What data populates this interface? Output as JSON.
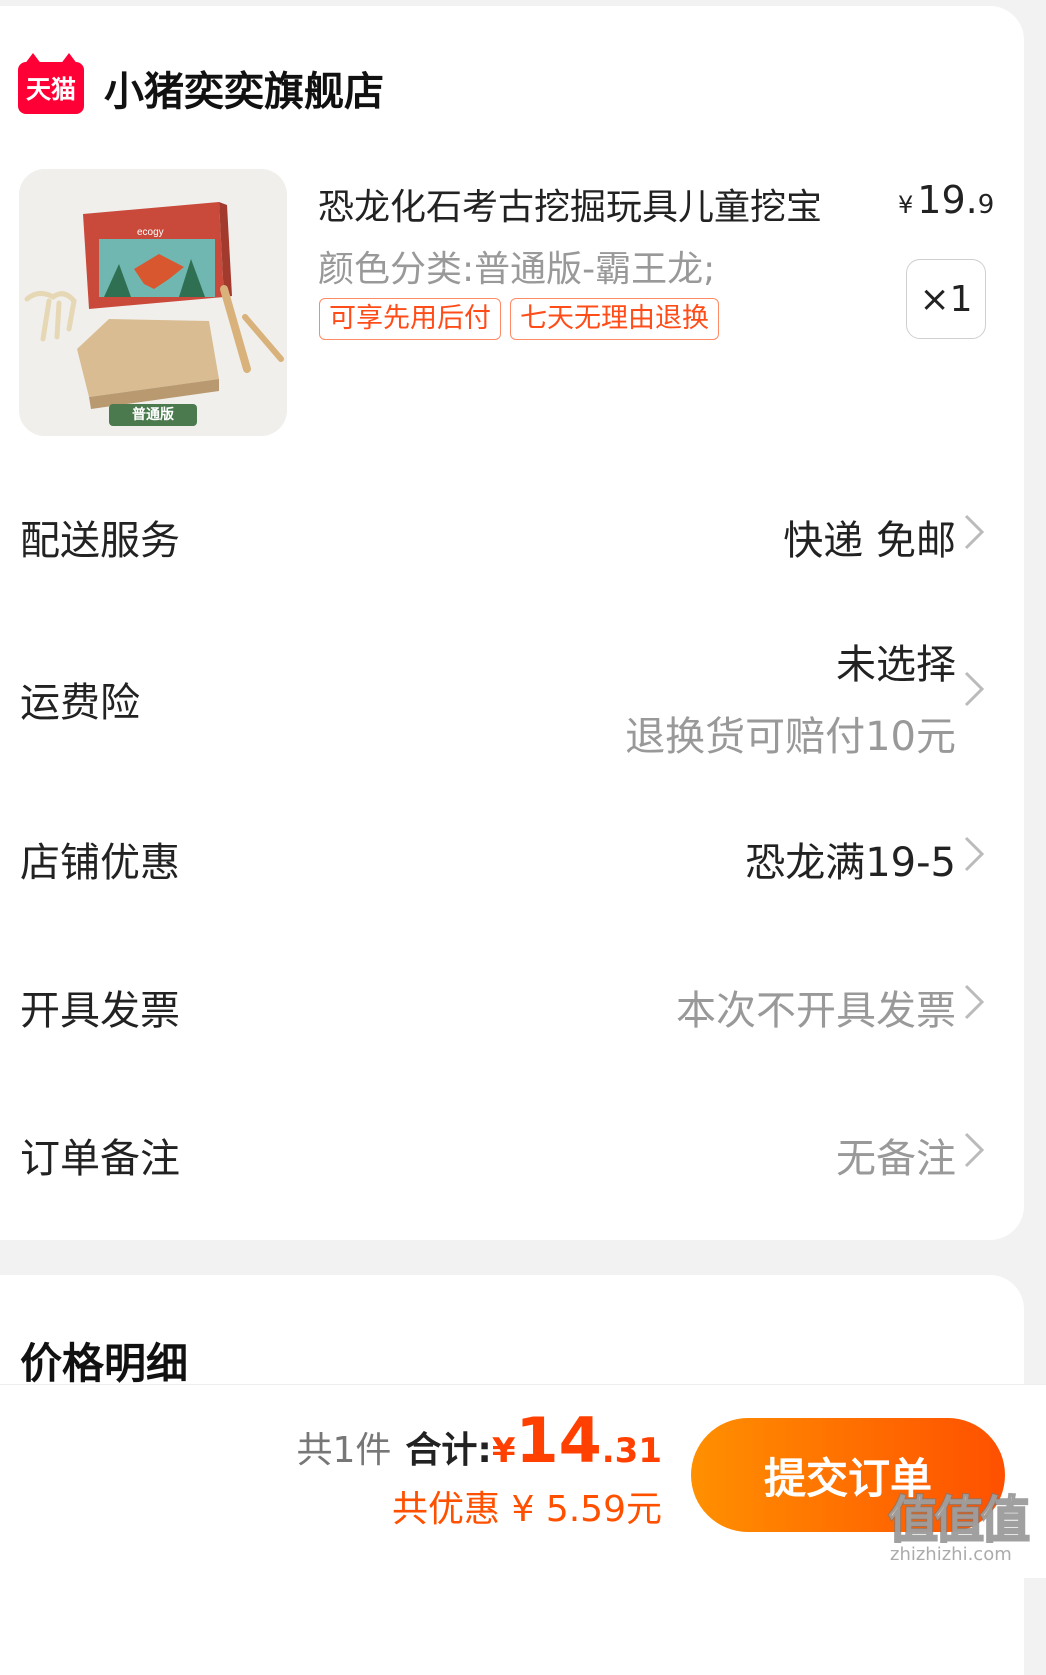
{
  "shop": {
    "badge": "天猫",
    "name": "小猪奕奕旗舰店"
  },
  "product": {
    "title": "恐龙化石考古挖掘玩具儿童挖宝",
    "price_symbol": "¥",
    "price_int": "19.",
    "price_dec": "9",
    "sku": "颜色分类:普通版-霸王龙;",
    "tags": [
      "可享先用后付",
      "七天无理由退换"
    ],
    "quantity": "×1",
    "image_label": "普通版",
    "box_label": "ecogy"
  },
  "rows": {
    "delivery": {
      "label": "配送服务",
      "value": "快递 免邮"
    },
    "insurance": {
      "label": "运费险",
      "value": "未选择",
      "sub": "退换货可赔付10元"
    },
    "discount": {
      "label": "店铺优惠",
      "value": "恐龙满19-5"
    },
    "invoice": {
      "label": "开具发票",
      "value": "本次不开具发票"
    },
    "note": {
      "label": "订单备注",
      "value": "无备注"
    }
  },
  "price_detail": {
    "title": "价格明细"
  },
  "footer": {
    "count": "共1件",
    "total_label": "合计:",
    "total_symbol": "¥",
    "total_int": "14",
    "total_dec": ".31",
    "discount_text": "共优惠 ¥ 5.59元",
    "submit_label": "提交订单"
  },
  "watermark": {
    "text": "值值值",
    "sub": "zhizhizhi.com"
  },
  "colors": {
    "accent": "#ff5000",
    "tmall_red": "#ff0036",
    "tag_border": "#ff8a66"
  }
}
